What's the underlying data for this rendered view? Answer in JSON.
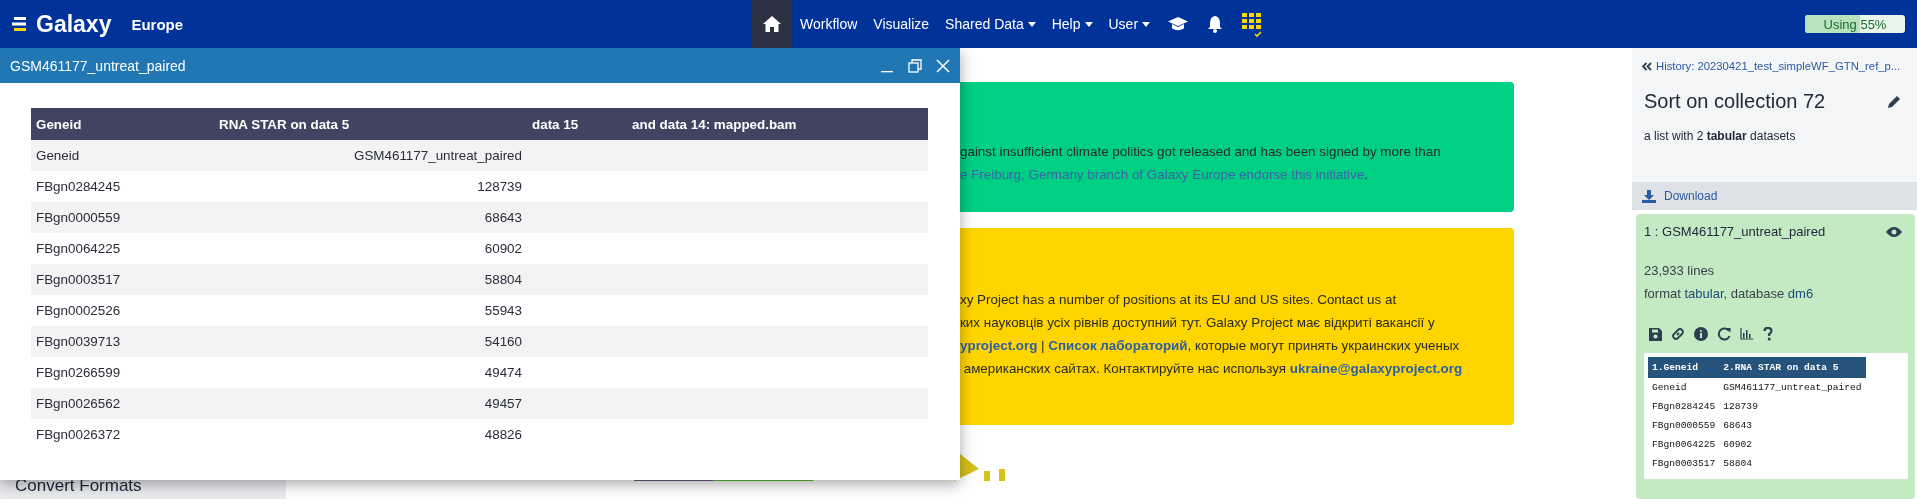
{
  "masthead": {
    "brand": "Galaxy",
    "subtitle": "Europe",
    "nav": [
      {
        "kind": "home",
        "selected": true
      },
      {
        "kind": "link",
        "label": "Workflow",
        "selected": false
      },
      {
        "kind": "link",
        "label": "Visualize",
        "selected": false
      },
      {
        "kind": "menu",
        "label": "Shared Data",
        "selected": false
      },
      {
        "kind": "menu",
        "label": "Help",
        "selected": false
      },
      {
        "kind": "menu",
        "label": "User",
        "selected": false
      },
      {
        "kind": "cap",
        "selected": false
      },
      {
        "kind": "bell",
        "selected": false
      },
      {
        "kind": "apps",
        "selected": false
      }
    ],
    "quota": {
      "label": "Using 55%",
      "level": 0.55
    }
  },
  "tool_panel": {
    "visible_item": "Convert Formats"
  },
  "notices": [
    {
      "color": "#00d084",
      "lines": [
        [
          {
            "text": "gainst insufficient climate politics got released and has been signed by more than",
            "link": false
          }
        ],
        [
          {
            "text": "e Freiburg, Germany branch of Galaxy Europe endorse this initiative",
            "link": true
          },
          {
            "text": ".",
            "link": false
          }
        ]
      ]
    },
    {
      "color": "#ffd500",
      "lines": [
        [
          {
            "text": "xy Project has a number of positions at its EU and US sites. Contact us at",
            "link": false
          }
        ],
        [
          {
            "text": "ких науковців усіх рівнів доступний тут. Galaxy Project має відкриті вакансії у",
            "link": false
          }
        ],
        [
          {
            "text": "yproject.org",
            "link": true
          },
          {
            "text": " | ",
            "link": false
          },
          {
            "text": "Список лабораторий",
            "link": true
          },
          {
            "text": ", которые могут принять украинских ученых",
            "link": false
          }
        ],
        [
          {
            "text": " американских сайтах. Контактируйте нас используя ",
            "link": false
          },
          {
            "text": "ukraine@galaxyproject.org",
            "link": true
          }
        ]
      ]
    }
  ],
  "dataset_window": {
    "title": "GSM461177_untreat_paired",
    "columns": [
      "Geneid",
      "RNA STAR on data 5",
      "data 15",
      "and data 14: mapped.bam"
    ],
    "rows": [
      [
        "Geneid",
        "GSM461177_untreat_paired"
      ],
      [
        "FBgn0284245",
        "128739"
      ],
      [
        "FBgn0000559",
        "68643"
      ],
      [
        "FBgn0064225",
        "60902"
      ],
      [
        "FBgn0003517",
        "58804"
      ],
      [
        "FBgn0002526",
        "55943"
      ],
      [
        "FBgn0039713",
        "54160"
      ],
      [
        "FBgn0266599",
        "49474"
      ],
      [
        "FBgn0026562",
        "49457"
      ],
      [
        "FBgn0026372",
        "48826"
      ]
    ]
  },
  "history": {
    "breadcrumb": "History: 20230421_test_simpleWF_GTN_ref_p...",
    "title": "Sort on collection 72",
    "summary": "a list with 2 **tabular** datasets",
    "download": "Download",
    "dataset": {
      "name": "1 : GSM461177_untreat_paired",
      "lines": "23,933 lines",
      "format_line": "format **tabular**,  database **dm6**",
      "peek": {
        "columns": [
          "1.Geneid",
          "2.RNA STAR on data 5"
        ],
        "rows": [
          [
            "Geneid",
            "GSM461177_untreat_paired"
          ],
          [
            "FBgn0284245",
            "128739"
          ],
          [
            "FBgn0000559",
            "68643"
          ],
          [
            "FBgn0064225",
            "60902"
          ],
          [
            "FBgn0003517",
            "58804"
          ]
        ]
      }
    }
  }
}
